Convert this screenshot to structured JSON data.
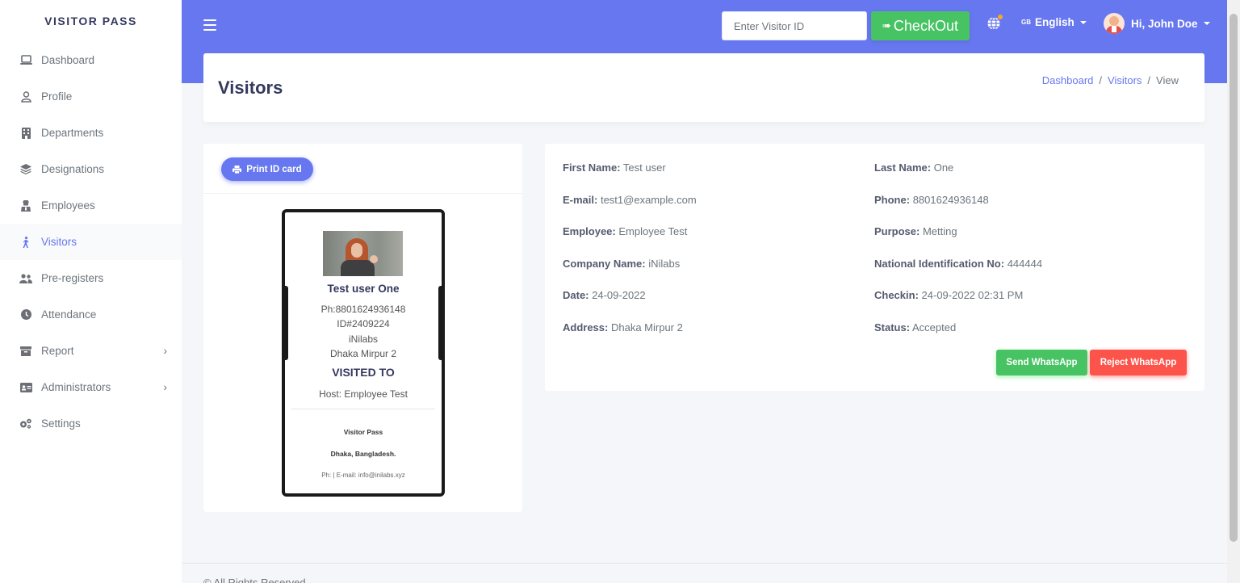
{
  "brand": "VISITOR PASS",
  "sidebar": {
    "items": [
      {
        "label": "Dashboard",
        "icon": "laptop-icon"
      },
      {
        "label": "Profile",
        "icon": "user-icon"
      },
      {
        "label": "Departments",
        "icon": "building-icon"
      },
      {
        "label": "Designations",
        "icon": "layers-icon"
      },
      {
        "label": "Employees",
        "icon": "user-tie-icon"
      },
      {
        "label": "Visitors",
        "icon": "walking-icon",
        "active": true
      },
      {
        "label": "Pre-registers",
        "icon": "users-icon"
      },
      {
        "label": "Attendance",
        "icon": "clock-icon"
      },
      {
        "label": "Report",
        "icon": "archive-icon",
        "has_submenu": true
      },
      {
        "label": "Administrators",
        "icon": "id-card-icon",
        "has_submenu": true
      },
      {
        "label": "Settings",
        "icon": "cogs-icon"
      }
    ]
  },
  "header": {
    "visitor_id_placeholder": "Enter Visitor ID",
    "checkout_label": "CheckOut",
    "language_flag": "GB",
    "language": "English",
    "user_greeting": "Hi, John Doe"
  },
  "page": {
    "title": "Visitors",
    "breadcrumb": [
      "Dashboard",
      "Visitors",
      "View"
    ],
    "separator": "/"
  },
  "id_card": {
    "print_label": "Print ID card",
    "name": "Test user One",
    "phone": "Ph:8801624936148",
    "id": "ID#2409224",
    "company": "iNilabs",
    "address": "Dhaka Mirpur 2",
    "visited_to": "VISITED TO",
    "host": "Host: Employee Test",
    "footer_title": "Visitor Pass",
    "footer_location": "Dhaka, Bangladesh.",
    "footer_contact": "Ph: | E-mail: info@inilabs.xyz"
  },
  "details": {
    "first_name": {
      "label": "First Name:",
      "value": "Test user"
    },
    "last_name": {
      "label": "Last Name:",
      "value": "One"
    },
    "email": {
      "label": "E-mail:",
      "value": "test1@example.com"
    },
    "phone": {
      "label": "Phone:",
      "value": "8801624936148"
    },
    "employee": {
      "label": "Employee:",
      "value": "Employee Test"
    },
    "purpose": {
      "label": "Purpose:",
      "value": "Metting"
    },
    "company": {
      "label": "Company Name:",
      "value": "iNilabs"
    },
    "nid": {
      "label": "National Identification No:",
      "value": "444444"
    },
    "date": {
      "label": "Date:",
      "value": "24-09-2022"
    },
    "checkin": {
      "label": "Checkin:",
      "value": "24-09-2022 02:31 PM"
    },
    "address": {
      "label": "Address:",
      "value": "Dhaka Mirpur 2"
    },
    "status": {
      "label": "Status:",
      "value": "Accepted"
    },
    "send_label": "Send WhatsApp",
    "reject_label": "Reject WhatsApp"
  },
  "footer": "© All Rights Reserved"
}
